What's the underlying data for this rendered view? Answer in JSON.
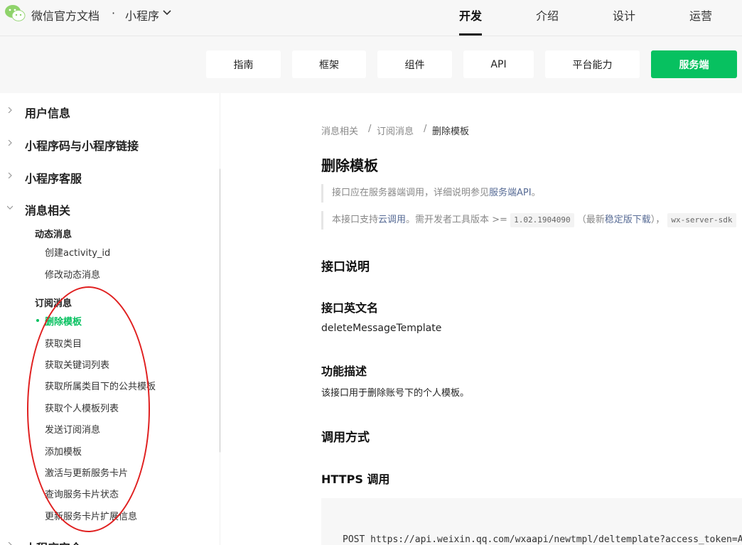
{
  "header": {
    "site_title": "微信官方文档",
    "separator": "·",
    "product": "小程序",
    "nav": [
      "开发",
      "介绍",
      "设计",
      "运营"
    ],
    "active_nav": "开发",
    "brand_color": "#07c160"
  },
  "subnav": {
    "tabs": [
      "指南",
      "框架",
      "组件",
      "API",
      "平台能力",
      "服务端"
    ],
    "active_tab": "服务端"
  },
  "sidebar": {
    "groups": {
      "user_info": "用户信息",
      "qrcode_link": "小程序码与小程序链接",
      "customer_service": "小程序客服",
      "message": "消息相关",
      "security": "小程序安全"
    },
    "dynamic_message": {
      "title": "动态消息",
      "items": [
        "创建activity_id",
        "修改动态消息"
      ]
    },
    "subscribe_message": {
      "title": "订阅消息",
      "items": [
        "删除模板",
        "获取类目",
        "获取关键词列表",
        "获取所属类目下的公共模板",
        "获取个人模板列表",
        "发送订阅消息",
        "添加模板",
        "激活与更新服务卡片",
        "查询服务卡片状态",
        "更新服务卡片扩展信息"
      ],
      "active_item": "删除模板"
    }
  },
  "content": {
    "breadcrumb": [
      "消息相关",
      "订阅消息",
      "删除模板"
    ],
    "breadcrumb_sep": "/",
    "title": "删除模板",
    "note1": {
      "text": "接口应在服务器端调用，详细说明参见",
      "link": "服务端API",
      "end": "。"
    },
    "note2": {
      "text1": "本接口支持",
      "link1": "云调用",
      "text2": "。需开发者工具版本 >= ",
      "version": "1.02.1904090",
      "text3": "（最新",
      "link2": "稳定版下载",
      "text4": "），",
      "sdk": "wx-server-sdk"
    },
    "section_api_desc": "接口说明",
    "section_api_name": "接口英文名",
    "api_name": "deleteMessageTemplate",
    "section_function": "功能描述",
    "function_text": "该接口用于删除账号下的个人模板。",
    "section_call": "调用方式",
    "section_https": "HTTPS 调用",
    "https_code": "POST https://api.weixin.qq.com/wxaapi/newtmpl/deltemplate?access_token=ACCESS_TOKEN"
  }
}
